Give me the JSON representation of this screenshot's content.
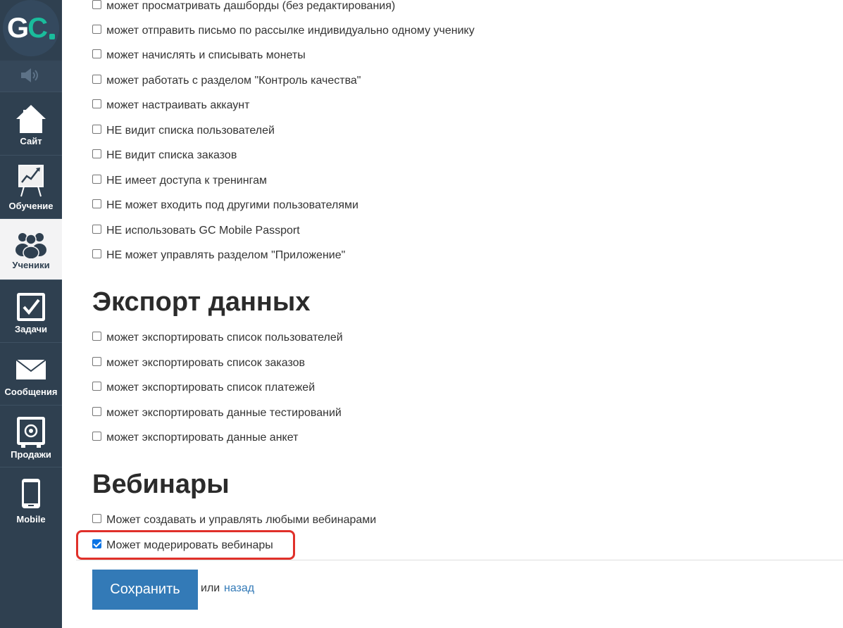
{
  "logo": {
    "text_g": "G",
    "text_c": "C"
  },
  "nav": [
    {
      "label": "Сайт",
      "icon": "home-icon"
    },
    {
      "label": "Обучение",
      "icon": "chart-board-icon"
    },
    {
      "label": "Ученики",
      "icon": "users-icon"
    },
    {
      "label": "Задачи",
      "icon": "checkbox-icon"
    },
    {
      "label": "Сообщения",
      "icon": "envelope-icon"
    },
    {
      "label": "Продажи",
      "icon": "safe-icon"
    },
    {
      "label": "Mobile",
      "icon": "phone-icon"
    }
  ],
  "permissions": [
    {
      "label": "может просматривать дашборды (без редактирования)",
      "checked": false
    },
    {
      "label": "может отправить письмо по рассылке индивидуально одному ученику",
      "checked": false
    },
    {
      "label": "может начислять и списывать монеты",
      "checked": false
    },
    {
      "label": "может работать с разделом \"Контроль качества\"",
      "checked": false
    },
    {
      "label": "может настраивать аккаунт",
      "checked": false
    },
    {
      "label": "НЕ видит списка пользователей",
      "checked": false
    },
    {
      "label": "НЕ видит списка заказов",
      "checked": false
    },
    {
      "label": "НЕ имеет доступа к тренингам",
      "checked": false
    },
    {
      "label": "НЕ может входить под другими пользователями",
      "checked": false
    },
    {
      "label": "НЕ использовать GC Mobile Passport",
      "checked": false
    },
    {
      "label": "НЕ может управлять разделом \"Приложение\"",
      "checked": false
    }
  ],
  "export": {
    "title": "Экспорт данных",
    "items": [
      {
        "label": "может экспортировать список пользователей",
        "checked": false
      },
      {
        "label": "может экспортировать список заказов",
        "checked": false
      },
      {
        "label": "может экспортировать список платежей",
        "checked": false
      },
      {
        "label": "может экспортировать данные тестирований",
        "checked": false
      },
      {
        "label": "может экспортировать данные анкет",
        "checked": false
      }
    ]
  },
  "webinars": {
    "title": "Вебинары",
    "items": [
      {
        "label": "Может создавать и управлять любыми вебинарами",
        "checked": false
      },
      {
        "label": "Может модерировать вебинары",
        "checked": true
      }
    ]
  },
  "form": {
    "save_label": "Сохранить",
    "or_text": "или",
    "back_label": "назад"
  },
  "colors": {
    "sidebar": "#2f4050",
    "accent": "#1abc9c",
    "primary": "#337ab7",
    "highlight": "#e0302a"
  }
}
